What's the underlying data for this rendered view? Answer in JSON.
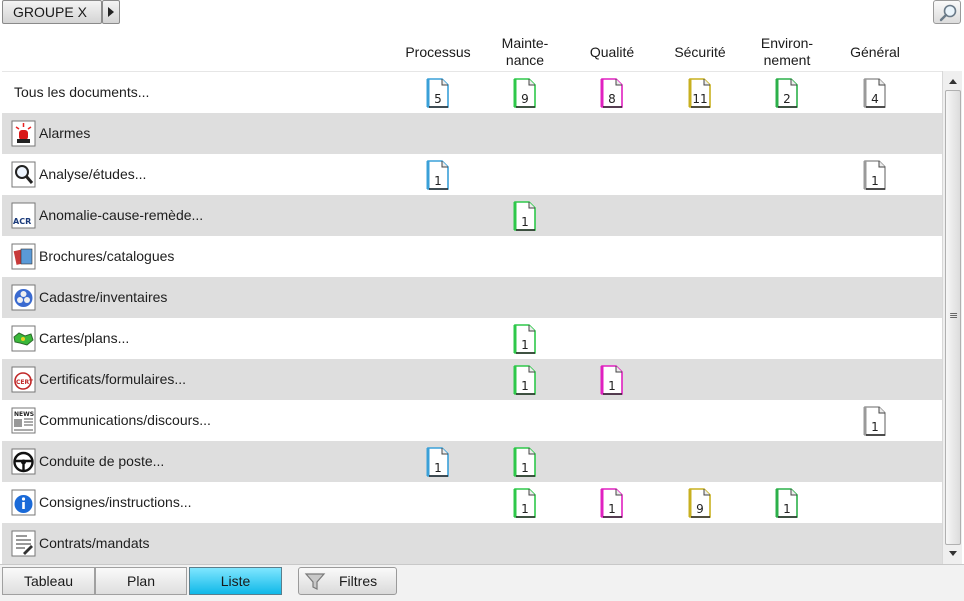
{
  "toolbar": {
    "group_label": "GROUPE X",
    "group_arrow_icon": "triangle-right-icon",
    "search_icon": "magnifier-icon"
  },
  "columns": [
    {
      "key": "processus",
      "label": "Processus",
      "color": "#3aa0d8"
    },
    {
      "key": "maintenance",
      "label": "Mainte-\nnance",
      "color": "#2ec84a"
    },
    {
      "key": "qualite",
      "label": "Qualité",
      "color": "#e020c0"
    },
    {
      "key": "securite",
      "label": "Sécurité",
      "color": "#c8b020"
    },
    {
      "key": "environnement",
      "label": "Environ-\nnement",
      "color": "#2cb04a"
    },
    {
      "key": "general",
      "label": "Général",
      "color": "#9a9a9a"
    }
  ],
  "rows": [
    {
      "label": "Tous les documents...",
      "icon": "",
      "counts": [
        "5",
        "9",
        "8",
        "11",
        "2",
        "4"
      ]
    },
    {
      "label": "Alarmes",
      "icon": "alarm-light-icon",
      "counts": [
        "",
        "",
        "",
        "",
        "",
        ""
      ]
    },
    {
      "label": "Analyse/études...",
      "icon": "magnifier-icon",
      "counts": [
        "1",
        "",
        "",
        "",
        "",
        "1"
      ]
    },
    {
      "label": "Anomalie-cause-remède...",
      "icon": "acr-icon",
      "counts": [
        "",
        "1",
        "",
        "",
        "",
        ""
      ]
    },
    {
      "label": "Brochures/catalogues",
      "icon": "brochure-icon",
      "counts": [
        "",
        "",
        "",
        "",
        "",
        ""
      ]
    },
    {
      "label": "Cadastre/inventaires",
      "icon": "inventory-icon",
      "counts": [
        "",
        "",
        "",
        "",
        "",
        ""
      ]
    },
    {
      "label": "Cartes/plans...",
      "icon": "map-icon",
      "counts": [
        "",
        "1",
        "",
        "",
        "",
        ""
      ]
    },
    {
      "label": "Certificats/formulaires...",
      "icon": "certificate-icon",
      "counts": [
        "",
        "1",
        "1",
        "",
        "",
        ""
      ]
    },
    {
      "label": "Communications/discours...",
      "icon": "newspaper-icon",
      "counts": [
        "",
        "",
        "",
        "",
        "",
        "1"
      ]
    },
    {
      "label": "Conduite de poste...",
      "icon": "steering-wheel-icon",
      "counts": [
        "1",
        "1",
        "",
        "",
        "",
        ""
      ]
    },
    {
      "label": "Consignes/instructions...",
      "icon": "info-icon",
      "counts": [
        "",
        "1",
        "1",
        "9",
        "1",
        ""
      ]
    },
    {
      "label": "Contrats/mandats",
      "icon": "contract-icon",
      "counts": [
        "",
        "",
        "",
        "",
        "",
        ""
      ]
    }
  ],
  "bottom": {
    "tabs": [
      {
        "label": "Tableau",
        "active": false
      },
      {
        "label": "Plan",
        "active": false
      },
      {
        "label": "Liste",
        "active": true
      }
    ],
    "filter_label": "Filtres",
    "filter_icon": "funnel-icon"
  }
}
